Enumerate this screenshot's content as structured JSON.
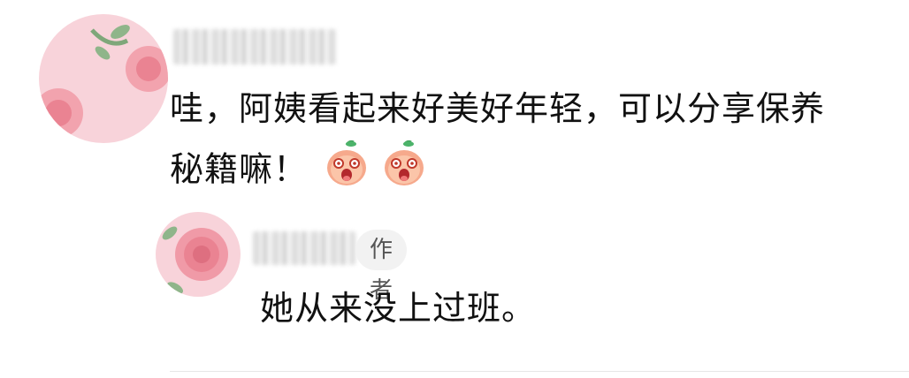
{
  "comment": {
    "author_name": "",
    "text_line1": "哇，阿姨看起来好美好年轻，可以分享保养",
    "text_line2": "秘籍嘛！",
    "emoji": [
      "smiling-peach-emoji",
      "smiling-peach-emoji"
    ]
  },
  "reply": {
    "author_name": "",
    "author_badge": "作者",
    "text": "她从来没上过班。"
  },
  "colors": {
    "avatar_pink": "#f7c6cf",
    "rose": "#ee8e9b",
    "leaf": "#7fa77a",
    "badge_bg": "#f2f2f2",
    "badge_text": "#555555"
  }
}
